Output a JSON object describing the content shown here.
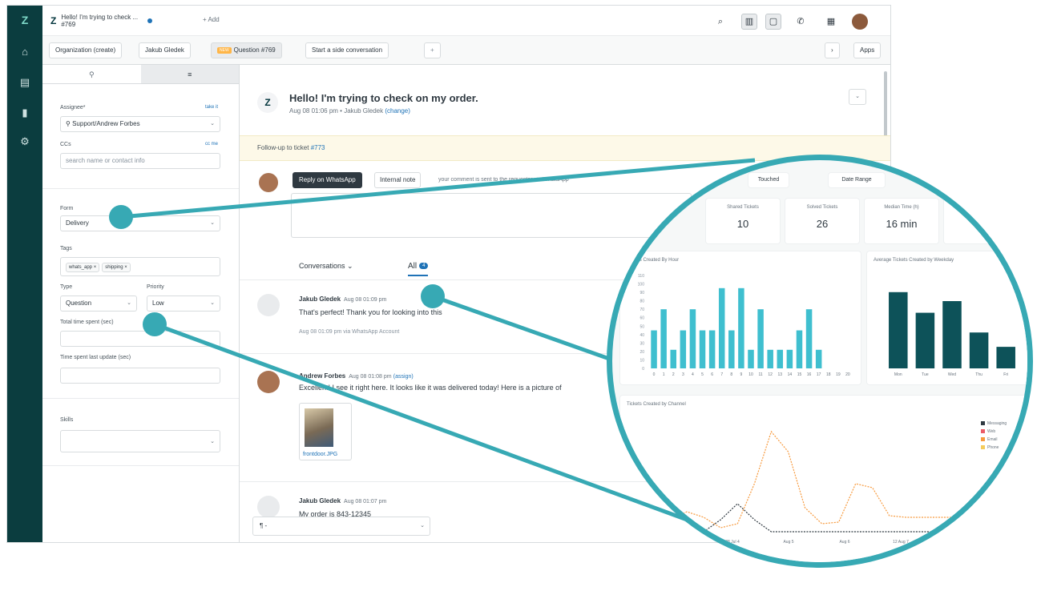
{
  "app": {
    "ticket_tab_title": "Hello! I'm trying to check ...",
    "ticket_tab_id": "#769",
    "add_label": "+ Add"
  },
  "subtabs": {
    "organization": "Organization (create)",
    "user": "Jakub Gledek",
    "new_badge": "NEW",
    "ticket": "Question #769",
    "side_conversation": "Start a side conversation",
    "plus": "+",
    "next": "›",
    "apps": "Apps"
  },
  "properties": {
    "assignee_label": "Assignee*",
    "take_it": "take it",
    "assignee_value": "Support/Andrew Forbes",
    "ccs_label": "CCs",
    "cc_me": "cc me",
    "ccs_placeholder": "search name or contact info",
    "form_label": "Form",
    "form_value": "Delivery",
    "tags_label": "Tags",
    "tags": [
      "whats_app ×",
      "shipping ×"
    ],
    "type_label": "Type",
    "type_value": "Question",
    "priority_label": "Priority",
    "priority_value": "Low",
    "total_time_label": "Total time spent (sec)",
    "last_update_label": "Time spent last update (sec)",
    "skills_label": "Skills"
  },
  "conversation": {
    "subject": "Hello! I'm trying to check on my order.",
    "meta_time": "Aug 08 01:06 pm",
    "meta_author": "Jakub Gledek",
    "meta_change": "(change)",
    "followup_text": "Follow-up to ticket ",
    "followup_link": "#773",
    "reply_button": "Reply on WhatsApp",
    "internal_note": "Internal note",
    "composer_hint": "your comment is sent to the requester via WhatsApp",
    "conversations_label": "Conversations",
    "all_label": "All",
    "all_count": "4",
    "messages": [
      {
        "name": "Jakub Gledek",
        "time": "Aug 08 01:09 pm",
        "body": "That's perfect! Thank you for looking into this",
        "sub": "Aug 08 01:09 pm via WhatsApp Account"
      },
      {
        "name": "Andrew Forbes",
        "time": "Aug 08 01:08 pm",
        "assign": "(assign)",
        "body": "Excellent! I see it right here. It looks like it was delivered today! Here is a picture of"
      },
      {
        "name": "Jakub Gledek",
        "time": "Aug 08 01:07 pm",
        "body": "My order is 843-12345"
      }
    ],
    "attachment_name": "frontdoor.JPG",
    "bottom_select": "¶ -"
  },
  "dashboard": {
    "buttons": [
      "Touched",
      "Date Range"
    ],
    "stats": [
      {
        "label": "Shared Tickets",
        "value": "10"
      },
      {
        "label": "Solved Tickets",
        "value": "26"
      },
      {
        "label": "Median Time (h)",
        "value": "16 min"
      }
    ],
    "chart1_title": "Tickets Created By Hour",
    "chart2_title": "Average Tickets Created by Weekday",
    "chart3_title": "Tickets Created by Channel"
  },
  "chart_data": [
    {
      "type": "bar",
      "title": "Tickets Created By Hour",
      "categories": [
        "0",
        "1",
        "2",
        "3",
        "4",
        "5",
        "6",
        "7",
        "8",
        "9",
        "10",
        "11",
        "12",
        "13",
        "14",
        "15",
        "16",
        "17",
        "18",
        "19",
        "20"
      ],
      "values": [
        45,
        70,
        22,
        45,
        70,
        45,
        45,
        95,
        45,
        95,
        22,
        70,
        22,
        22,
        22,
        45,
        70,
        22,
        0,
        0,
        0
      ],
      "ylim": [
        0,
        110
      ],
      "ytick_labels": [
        "110",
        "100",
        "90",
        "80",
        "70",
        "60",
        "50",
        "40",
        "30",
        "20",
        "10",
        "0"
      ],
      "color": "#3fbfcf"
    },
    {
      "type": "bar",
      "title": "Average Tickets Created by Weekday",
      "categories": [
        "Mon",
        "Tue",
        "Wed",
        "Thu",
        "Fri"
      ],
      "values": [
        8.5,
        6.2,
        7.5,
        4,
        2.4
      ],
      "ylim": [
        0,
        10
      ],
      "color": "#0d5259"
    },
    {
      "type": "line",
      "title": "Tickets Created by Channel",
      "x_labels": [
        "28 Jul 4",
        "Aug 5",
        "Aug 6",
        "12 Aug 7"
      ],
      "series": [
        {
          "values": [
            0,
            0,
            0,
            0,
            0,
            15,
            35,
            15,
            0,
            0,
            0,
            0,
            0,
            0,
            0,
            0,
            0,
            0,
            0,
            0
          ],
          "color": "#2f3941"
        },
        {
          "values": [
            0,
            5,
            15,
            25,
            18,
            5,
            10,
            60,
            125,
            100,
            30,
            10,
            12,
            60,
            55,
            20,
            18,
            18,
            18,
            18
          ],
          "color": "#f79a3e"
        }
      ],
      "legend": [
        "Messaging",
        "Web",
        "Email",
        "Phone"
      ],
      "legend_colors": [
        "#2f3941",
        "#eb5c69",
        "#f79a3e",
        "#f5cc5c"
      ],
      "legend_position": "right"
    }
  ]
}
